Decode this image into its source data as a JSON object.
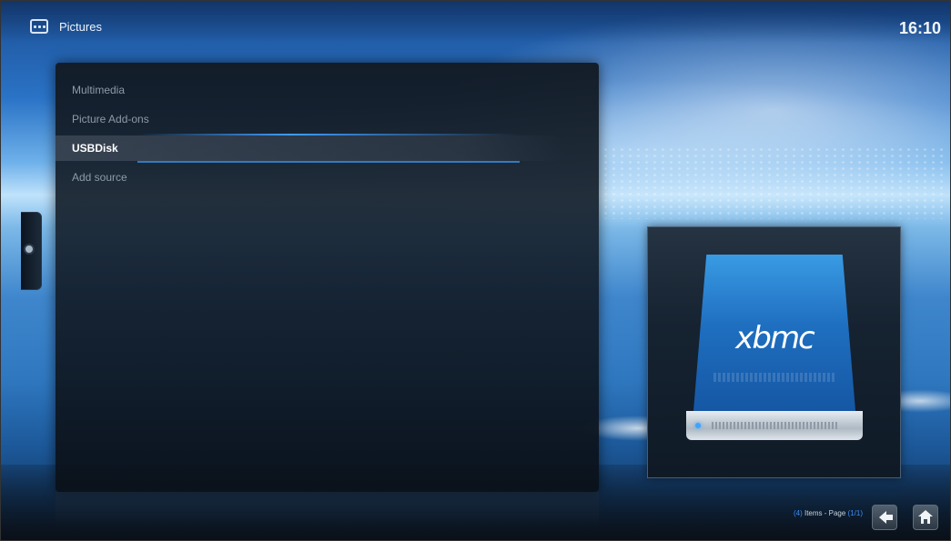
{
  "header": {
    "title": "Pictures",
    "clock": "16:10",
    "icon": "pictures-icon"
  },
  "menu": {
    "items": [
      {
        "label": "Multimedia",
        "selected": false
      },
      {
        "label": "Picture Add-ons",
        "selected": false
      },
      {
        "label": "USBDisk",
        "selected": true
      },
      {
        "label": "Add source",
        "selected": false
      }
    ]
  },
  "preview": {
    "logo_text": "xbmc",
    "icon": "usb-drive-icon"
  },
  "footer": {
    "count": "(4)",
    "items_text": " Items - Page ",
    "page": "(1/1)",
    "back_icon": "back-arrow-icon",
    "home_icon": "home-icon"
  },
  "colors": {
    "accent": "#3e8ef0",
    "selected_text": "#ffffff",
    "menu_text": "#8d9aa8"
  }
}
